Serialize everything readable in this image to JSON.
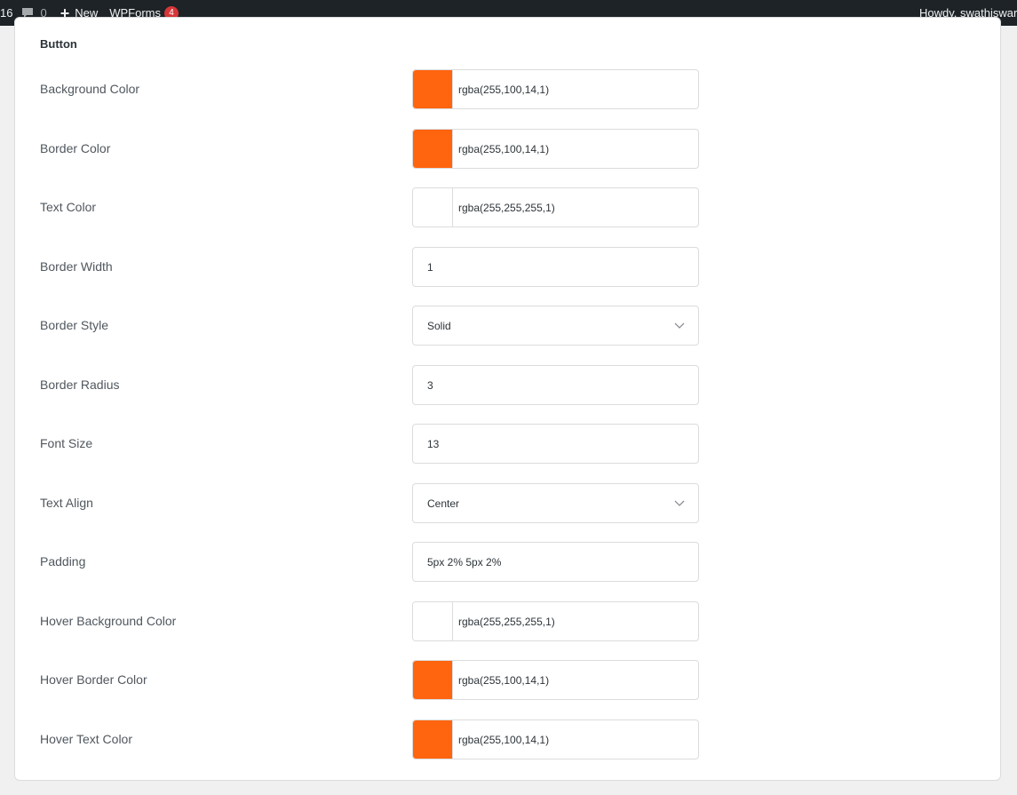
{
  "adminbar": {
    "site_count": "16",
    "comments_count": "0",
    "new_label": "New",
    "wpforms_label": "WPForms",
    "wpforms_badge": "4",
    "howdy": "Howdy, swathiswaroo"
  },
  "section": {
    "title": "Button"
  },
  "fields": [
    {
      "label": "Background Color",
      "type": "color",
      "value": "rgba(255,100,14,1)",
      "swatch": "#ff640e"
    },
    {
      "label": "Border Color",
      "type": "color",
      "value": "rgba(255,100,14,1)",
      "swatch": "#ff640e"
    },
    {
      "label": "Text Color",
      "type": "color",
      "value": "rgba(255,255,255,1)",
      "swatch": "#ffffff"
    },
    {
      "label": "Border Width",
      "type": "text",
      "value": "1"
    },
    {
      "label": "Border Style",
      "type": "select",
      "value": "Solid"
    },
    {
      "label": "Border Radius",
      "type": "text",
      "value": "3"
    },
    {
      "label": "Font Size",
      "type": "text",
      "value": "13"
    },
    {
      "label": "Text Align",
      "type": "select",
      "value": "Center"
    },
    {
      "label": "Padding",
      "type": "text",
      "value": "5px 2% 5px 2%"
    },
    {
      "label": "Hover Background Color",
      "type": "color",
      "value": "rgba(255,255,255,1)",
      "swatch": "#ffffff"
    },
    {
      "label": "Hover Border Color",
      "type": "color",
      "value": "rgba(255,100,14,1)",
      "swatch": "#ff640e"
    },
    {
      "label": "Hover Text Color",
      "type": "color",
      "value": "rgba(255,100,14,1)",
      "swatch": "#ff640e"
    }
  ]
}
